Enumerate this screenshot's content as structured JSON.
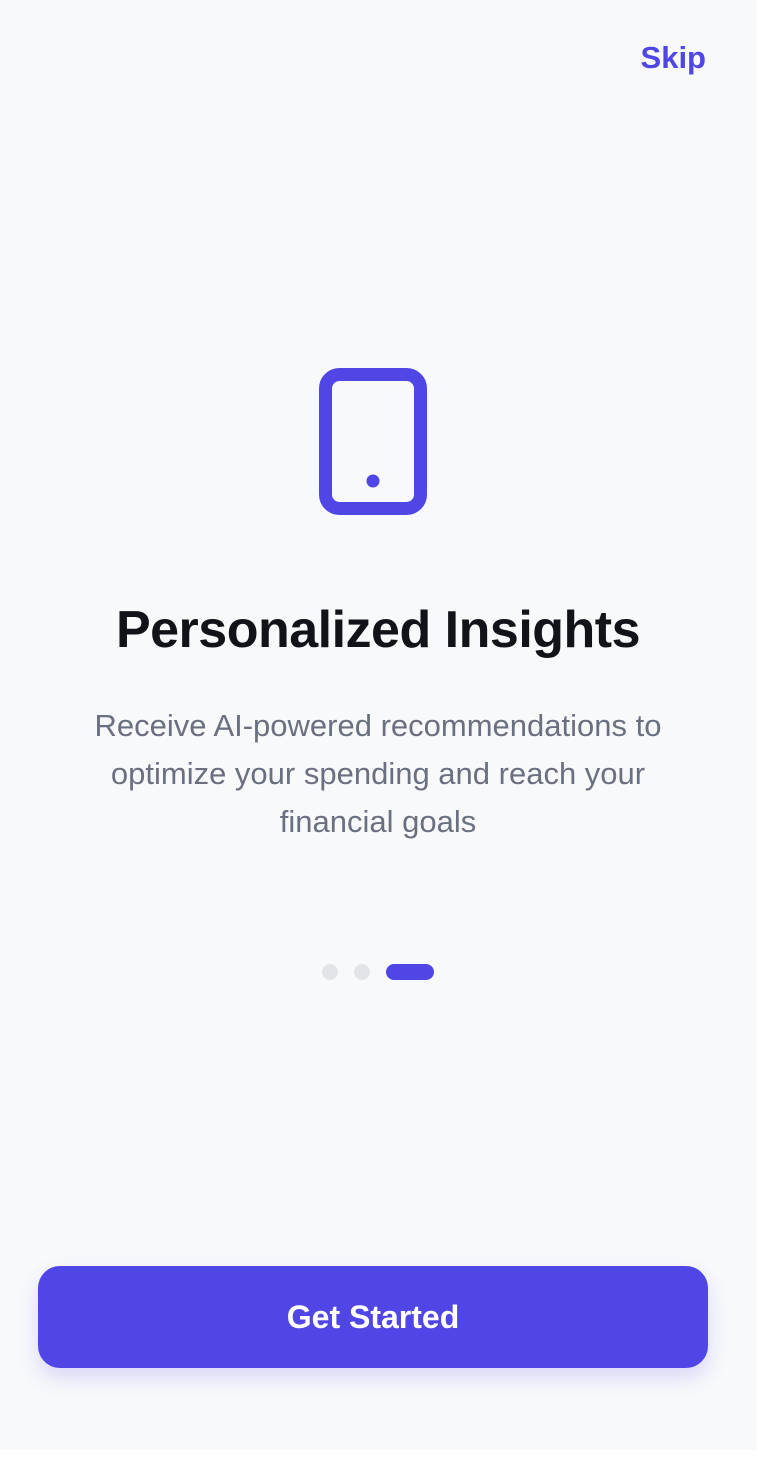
{
  "header": {
    "skip_label": "Skip"
  },
  "slide": {
    "icon": "smartphone-icon",
    "title": "Personalized Insights",
    "description": "Receive AI-powered recommendations to optimize your spending and reach your financial goals"
  },
  "pager": {
    "total": 3,
    "active_index": 2
  },
  "cta": {
    "label": "Get Started"
  },
  "colors": {
    "accent": "#4f46e5",
    "background": "#f8f9fb",
    "title": "#111318",
    "body_text": "#6b7080",
    "inactive_dot": "#e3e4e8"
  }
}
